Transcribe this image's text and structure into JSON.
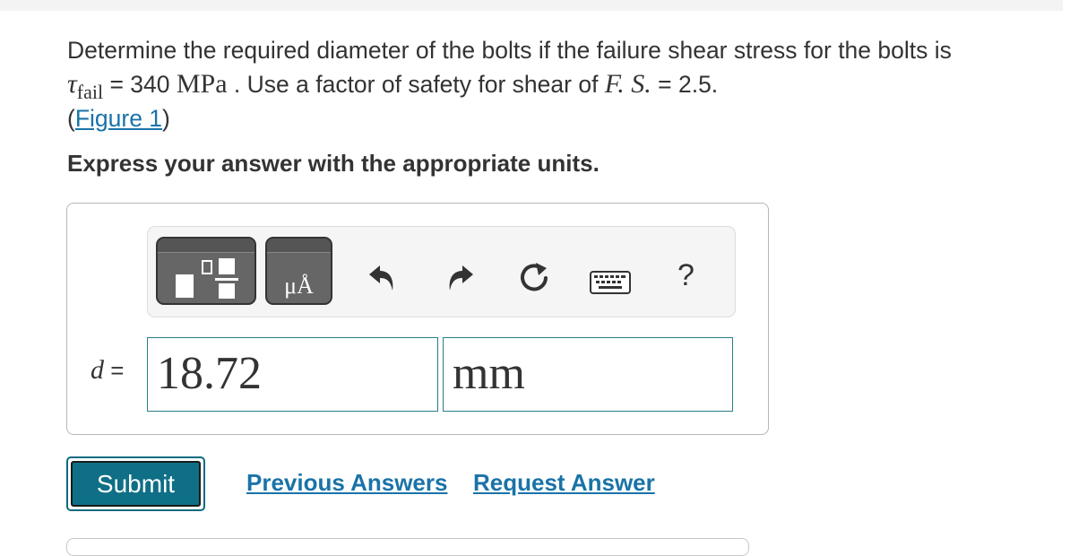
{
  "problem": {
    "line1": "Determine the required diameter of the bolts if the failure shear stress for the bolts is",
    "tau_symbol": "τ",
    "tau_subscript": "fail",
    "equals1": " = 340 ",
    "stress_unit": "MPa",
    "sentence2": " . Use a factor of safety for shear of ",
    "fs_symbol": "F. S.",
    "fs_value": " = 2.5.",
    "figure_open": "(",
    "figure_link": "Figure 1",
    "figure_close": ")"
  },
  "instruction": "Express your answer with the appropriate units.",
  "toolbar": {
    "template_icon": "fraction-template-icon",
    "units_icon": "units-template-icon",
    "units_glyph": "μÅ",
    "undo_icon": "undo-icon",
    "redo_icon": "redo-icon",
    "reset_icon": "reset-icon",
    "keyboard_icon": "keyboard-icon",
    "help_label": "?"
  },
  "answer": {
    "variable": "d",
    "equals": " =",
    "value": "18.72",
    "unit": "mm"
  },
  "actions": {
    "submit": "Submit",
    "previous_answers": "Previous Answers",
    "request_answer": "Request Answer"
  },
  "colors": {
    "accent": "#0e6f86",
    "link": "#1a73a8",
    "field_border": "#2a7d8c"
  }
}
